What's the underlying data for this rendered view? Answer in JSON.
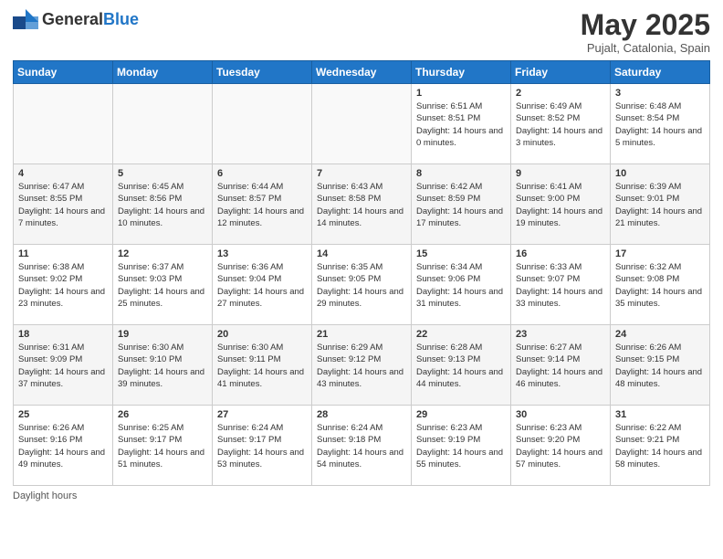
{
  "header": {
    "logo_general": "General",
    "logo_blue": "Blue",
    "month_title": "May 2025",
    "location": "Pujalt, Catalonia, Spain"
  },
  "days_of_week": [
    "Sunday",
    "Monday",
    "Tuesday",
    "Wednesday",
    "Thursday",
    "Friday",
    "Saturday"
  ],
  "weeks": [
    [
      {
        "day": "",
        "info": ""
      },
      {
        "day": "",
        "info": ""
      },
      {
        "day": "",
        "info": ""
      },
      {
        "day": "",
        "info": ""
      },
      {
        "day": "1",
        "info": "Sunrise: 6:51 AM\nSunset: 8:51 PM\nDaylight: 14 hours and 0 minutes."
      },
      {
        "day": "2",
        "info": "Sunrise: 6:49 AM\nSunset: 8:52 PM\nDaylight: 14 hours and 3 minutes."
      },
      {
        "day": "3",
        "info": "Sunrise: 6:48 AM\nSunset: 8:54 PM\nDaylight: 14 hours and 5 minutes."
      }
    ],
    [
      {
        "day": "4",
        "info": "Sunrise: 6:47 AM\nSunset: 8:55 PM\nDaylight: 14 hours and 7 minutes."
      },
      {
        "day": "5",
        "info": "Sunrise: 6:45 AM\nSunset: 8:56 PM\nDaylight: 14 hours and 10 minutes."
      },
      {
        "day": "6",
        "info": "Sunrise: 6:44 AM\nSunset: 8:57 PM\nDaylight: 14 hours and 12 minutes."
      },
      {
        "day": "7",
        "info": "Sunrise: 6:43 AM\nSunset: 8:58 PM\nDaylight: 14 hours and 14 minutes."
      },
      {
        "day": "8",
        "info": "Sunrise: 6:42 AM\nSunset: 8:59 PM\nDaylight: 14 hours and 17 minutes."
      },
      {
        "day": "9",
        "info": "Sunrise: 6:41 AM\nSunset: 9:00 PM\nDaylight: 14 hours and 19 minutes."
      },
      {
        "day": "10",
        "info": "Sunrise: 6:39 AM\nSunset: 9:01 PM\nDaylight: 14 hours and 21 minutes."
      }
    ],
    [
      {
        "day": "11",
        "info": "Sunrise: 6:38 AM\nSunset: 9:02 PM\nDaylight: 14 hours and 23 minutes."
      },
      {
        "day": "12",
        "info": "Sunrise: 6:37 AM\nSunset: 9:03 PM\nDaylight: 14 hours and 25 minutes."
      },
      {
        "day": "13",
        "info": "Sunrise: 6:36 AM\nSunset: 9:04 PM\nDaylight: 14 hours and 27 minutes."
      },
      {
        "day": "14",
        "info": "Sunrise: 6:35 AM\nSunset: 9:05 PM\nDaylight: 14 hours and 29 minutes."
      },
      {
        "day": "15",
        "info": "Sunrise: 6:34 AM\nSunset: 9:06 PM\nDaylight: 14 hours and 31 minutes."
      },
      {
        "day": "16",
        "info": "Sunrise: 6:33 AM\nSunset: 9:07 PM\nDaylight: 14 hours and 33 minutes."
      },
      {
        "day": "17",
        "info": "Sunrise: 6:32 AM\nSunset: 9:08 PM\nDaylight: 14 hours and 35 minutes."
      }
    ],
    [
      {
        "day": "18",
        "info": "Sunrise: 6:31 AM\nSunset: 9:09 PM\nDaylight: 14 hours and 37 minutes."
      },
      {
        "day": "19",
        "info": "Sunrise: 6:30 AM\nSunset: 9:10 PM\nDaylight: 14 hours and 39 minutes."
      },
      {
        "day": "20",
        "info": "Sunrise: 6:30 AM\nSunset: 9:11 PM\nDaylight: 14 hours and 41 minutes."
      },
      {
        "day": "21",
        "info": "Sunrise: 6:29 AM\nSunset: 9:12 PM\nDaylight: 14 hours and 43 minutes."
      },
      {
        "day": "22",
        "info": "Sunrise: 6:28 AM\nSunset: 9:13 PM\nDaylight: 14 hours and 44 minutes."
      },
      {
        "day": "23",
        "info": "Sunrise: 6:27 AM\nSunset: 9:14 PM\nDaylight: 14 hours and 46 minutes."
      },
      {
        "day": "24",
        "info": "Sunrise: 6:26 AM\nSunset: 9:15 PM\nDaylight: 14 hours and 48 minutes."
      }
    ],
    [
      {
        "day": "25",
        "info": "Sunrise: 6:26 AM\nSunset: 9:16 PM\nDaylight: 14 hours and 49 minutes."
      },
      {
        "day": "26",
        "info": "Sunrise: 6:25 AM\nSunset: 9:17 PM\nDaylight: 14 hours and 51 minutes."
      },
      {
        "day": "27",
        "info": "Sunrise: 6:24 AM\nSunset: 9:17 PM\nDaylight: 14 hours and 53 minutes."
      },
      {
        "day": "28",
        "info": "Sunrise: 6:24 AM\nSunset: 9:18 PM\nDaylight: 14 hours and 54 minutes."
      },
      {
        "day": "29",
        "info": "Sunrise: 6:23 AM\nSunset: 9:19 PM\nDaylight: 14 hours and 55 minutes."
      },
      {
        "day": "30",
        "info": "Sunrise: 6:23 AM\nSunset: 9:20 PM\nDaylight: 14 hours and 57 minutes."
      },
      {
        "day": "31",
        "info": "Sunrise: 6:22 AM\nSunset: 9:21 PM\nDaylight: 14 hours and 58 minutes."
      }
    ]
  ],
  "footer": "Daylight hours"
}
